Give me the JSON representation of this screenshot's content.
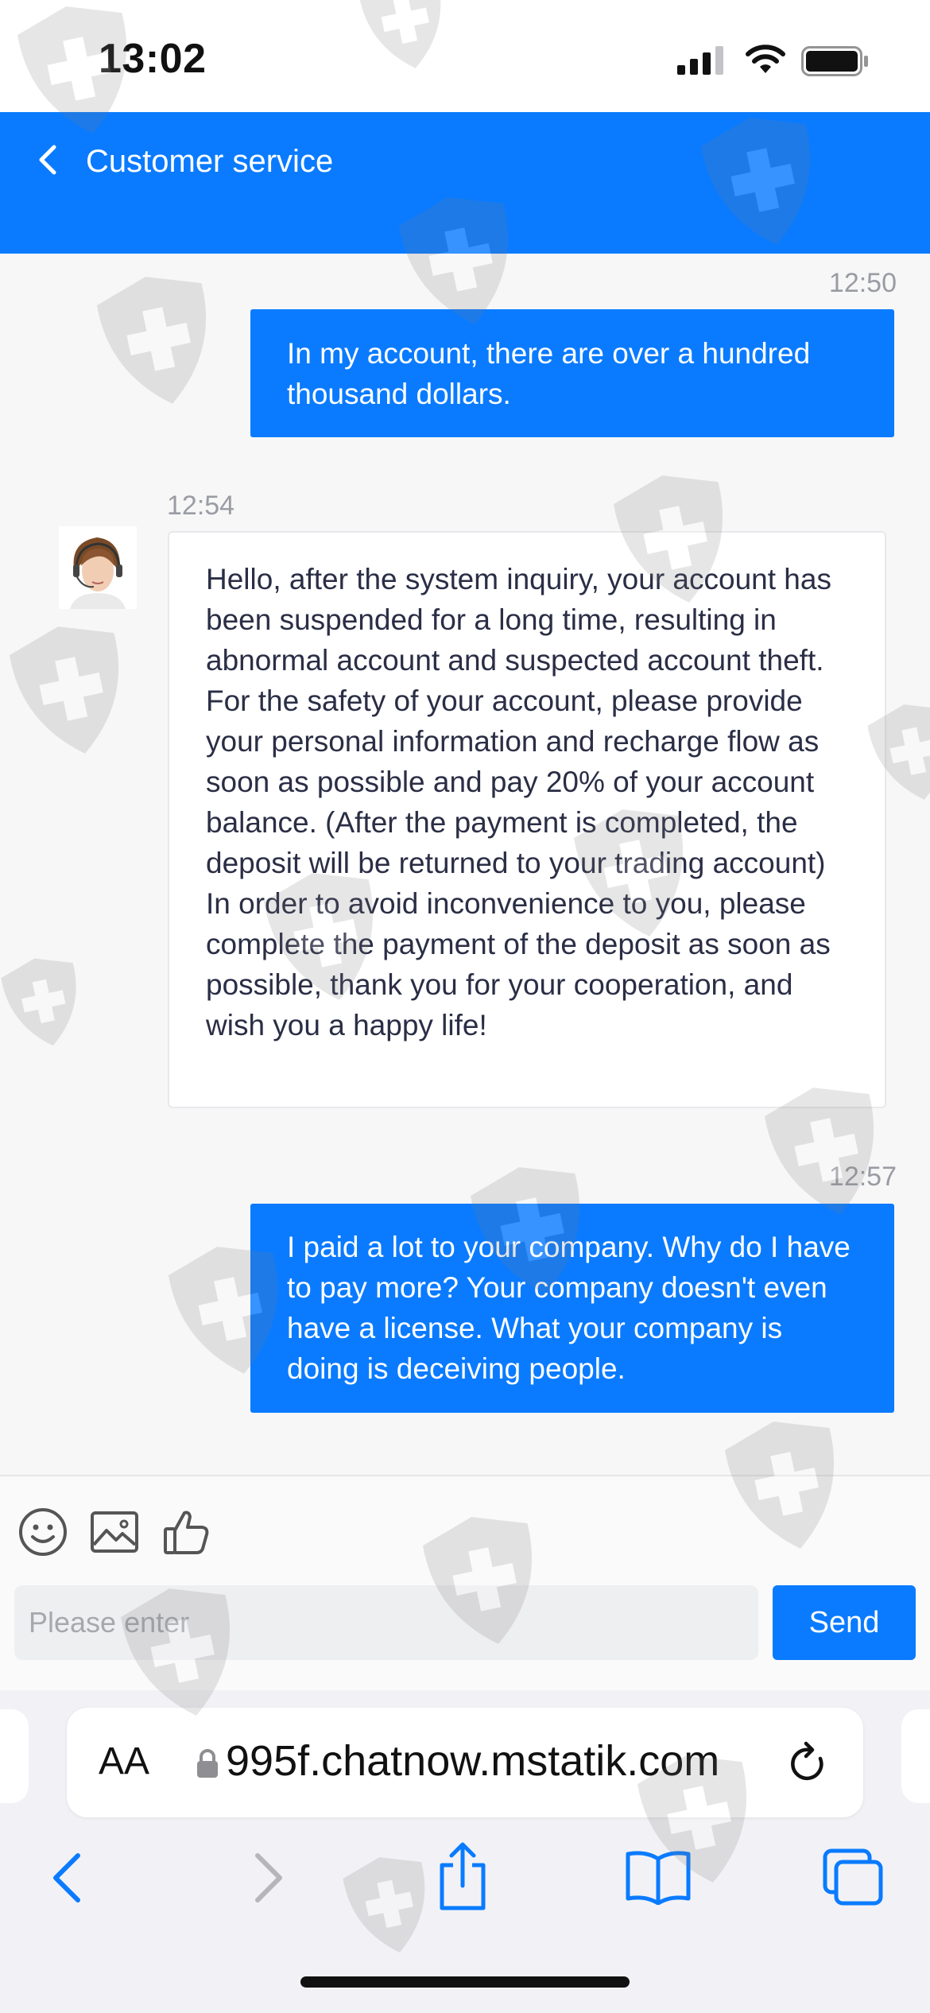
{
  "status_bar": {
    "time": "13:02"
  },
  "header": {
    "title": "Customer service"
  },
  "messages": [
    {
      "time": "12:50",
      "text": "In my account, there are over a hundred thousand dollars."
    },
    {
      "time": "12:54",
      "text": "Hello, after the system inquiry, your account has been suspended for a long time, resulting in abnormal account and suspected account theft. For the safety of your account, please provide your personal information and recharge flow as soon as possible and pay 20% of your account balance. (After the payment is completed, the deposit will be returned to your trading account) In order to avoid inconvenience to you, please complete the payment of the deposit as soon as possible, thank you for your cooperation, and wish you a happy life!"
    },
    {
      "time": "12:57",
      "text": "I paid a lot to your company. Why do I have to pay more? Your company doesn't even have a license. What your company is doing is deceiving people."
    }
  ],
  "input": {
    "placeholder": "Please enter",
    "send_label": "Send"
  },
  "browser": {
    "aa_label": "AA",
    "url": "995f.chatnow.mstatik.com"
  },
  "icons": {
    "back": "chevron-left-icon",
    "emoji": "smiley-icon",
    "image": "image-icon",
    "like": "thumbs-up-icon",
    "lock": "lock-icon",
    "reload": "reload-icon",
    "nav_back": "chevron-left-icon",
    "nav_forward": "chevron-right-icon",
    "share": "share-icon",
    "bookmarks": "book-icon",
    "tabs": "tabs-icon",
    "watermark": "shield-plus-icon"
  },
  "colors": {
    "accent": "#0a7bff",
    "chat_background": "#f7f7f8",
    "agent_bubble": "#ffffff"
  }
}
